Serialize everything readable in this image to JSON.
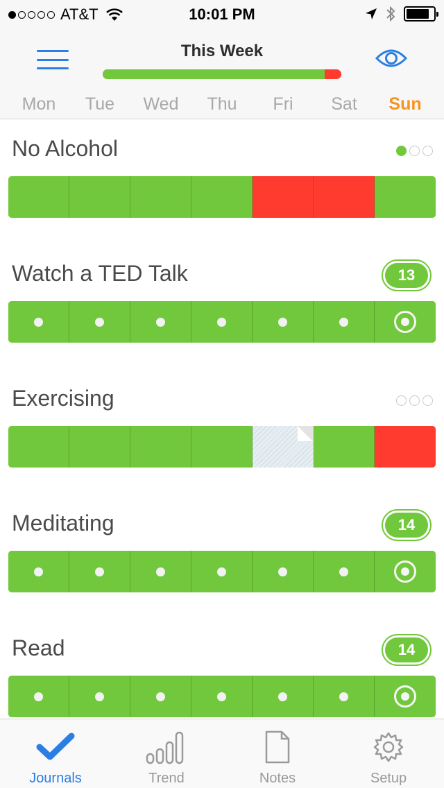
{
  "status_bar": {
    "carrier": "AT&T",
    "time": "10:01 PM",
    "signal_bars": 1,
    "battery_level": 0.85
  },
  "header": {
    "title": "This Week",
    "week_progress": 0.93,
    "days": [
      {
        "label": "Mon",
        "today": false
      },
      {
        "label": "Tue",
        "today": false
      },
      {
        "label": "Wed",
        "today": false
      },
      {
        "label": "Thu",
        "today": false
      },
      {
        "label": "Fri",
        "today": false
      },
      {
        "label": "Sat",
        "today": false
      },
      {
        "label": "Sun",
        "today": true
      }
    ]
  },
  "colors": {
    "accent": "#2b7ee3",
    "success": "#72c83c",
    "failure": "#ff3b30",
    "today": "#f7931e"
  },
  "habits": [
    {
      "name": "No Alcohol",
      "indicator": "dots",
      "dots": [
        true,
        false,
        false
      ],
      "days": [
        "green",
        "green",
        "green",
        "green",
        "red",
        "red",
        "green"
      ]
    },
    {
      "name": "Watch a TED Talk",
      "indicator": "count",
      "count": "13",
      "days": [
        "green-dot",
        "green-dot",
        "green-dot",
        "green-dot",
        "green-dot",
        "green-dot",
        "green-target"
      ]
    },
    {
      "name": "Exercising",
      "indicator": "dots",
      "dots": [
        false,
        false,
        false
      ],
      "days": [
        "green",
        "green",
        "green",
        "green",
        "note",
        "green",
        "red"
      ]
    },
    {
      "name": "Meditating",
      "indicator": "count",
      "count": "14",
      "days": [
        "green-dot",
        "green-dot",
        "green-dot",
        "green-dot",
        "green-dot",
        "green-dot",
        "green-target"
      ]
    },
    {
      "name": "Read",
      "indicator": "count",
      "count": "14",
      "days": [
        "green-dot",
        "green-dot",
        "green-dot",
        "green-dot",
        "green-dot",
        "green-dot",
        "green-target"
      ]
    }
  ],
  "tabs": [
    {
      "label": "Journals",
      "icon": "checkmark-icon",
      "active": true
    },
    {
      "label": "Trend",
      "icon": "bar-chart-icon",
      "active": false
    },
    {
      "label": "Notes",
      "icon": "document-icon",
      "active": false
    },
    {
      "label": "Setup",
      "icon": "gear-icon",
      "active": false
    }
  ]
}
